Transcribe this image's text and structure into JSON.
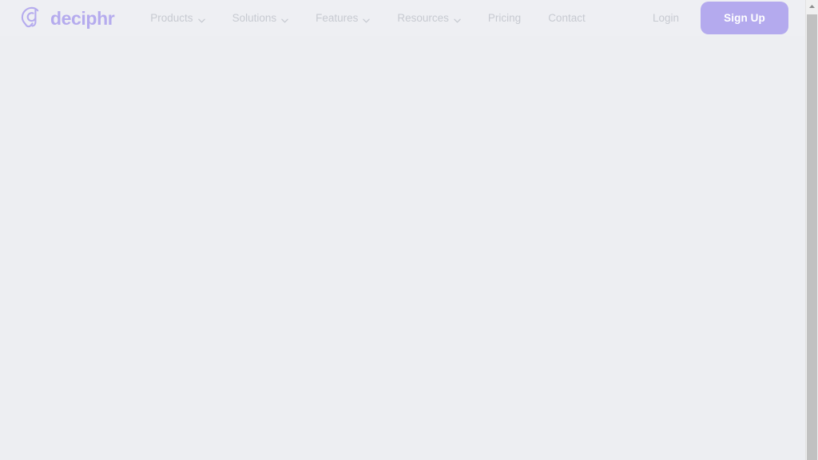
{
  "page": {
    "background_color": "#edeef2",
    "state": "blank-loading",
    "main_content_text": ""
  },
  "header": {
    "background_color": "#eeeff3",
    "brand": {
      "name": "deciphr",
      "logo_icon": "deciphr-speech-bubble-d-icon",
      "color": "#b5abee"
    },
    "nav_items": [
      {
        "label": "Products",
        "has_dropdown": true,
        "icon": "chevron-down-icon"
      },
      {
        "label": "Solutions",
        "has_dropdown": true,
        "icon": "chevron-down-icon"
      },
      {
        "label": "Features",
        "has_dropdown": true,
        "icon": "chevron-down-icon"
      },
      {
        "label": "Resources",
        "has_dropdown": true,
        "icon": "chevron-down-icon"
      },
      {
        "label": "Pricing",
        "has_dropdown": false,
        "icon": ""
      },
      {
        "label": "Contact",
        "has_dropdown": false,
        "icon": ""
      }
    ],
    "nav_text_color": "#c7cad1",
    "actions": {
      "login_label": "Login",
      "signup_label": "Sign Up",
      "signup_bg_color": "#b4aaee",
      "signup_text_color": "#ffffff"
    }
  },
  "scrollbar": {
    "orientation": "vertical",
    "up_arrow_icon": "triangle-up-icon",
    "thumb_color": "#c1c1c1",
    "track_color": "#f0f0f0",
    "position": "top"
  }
}
